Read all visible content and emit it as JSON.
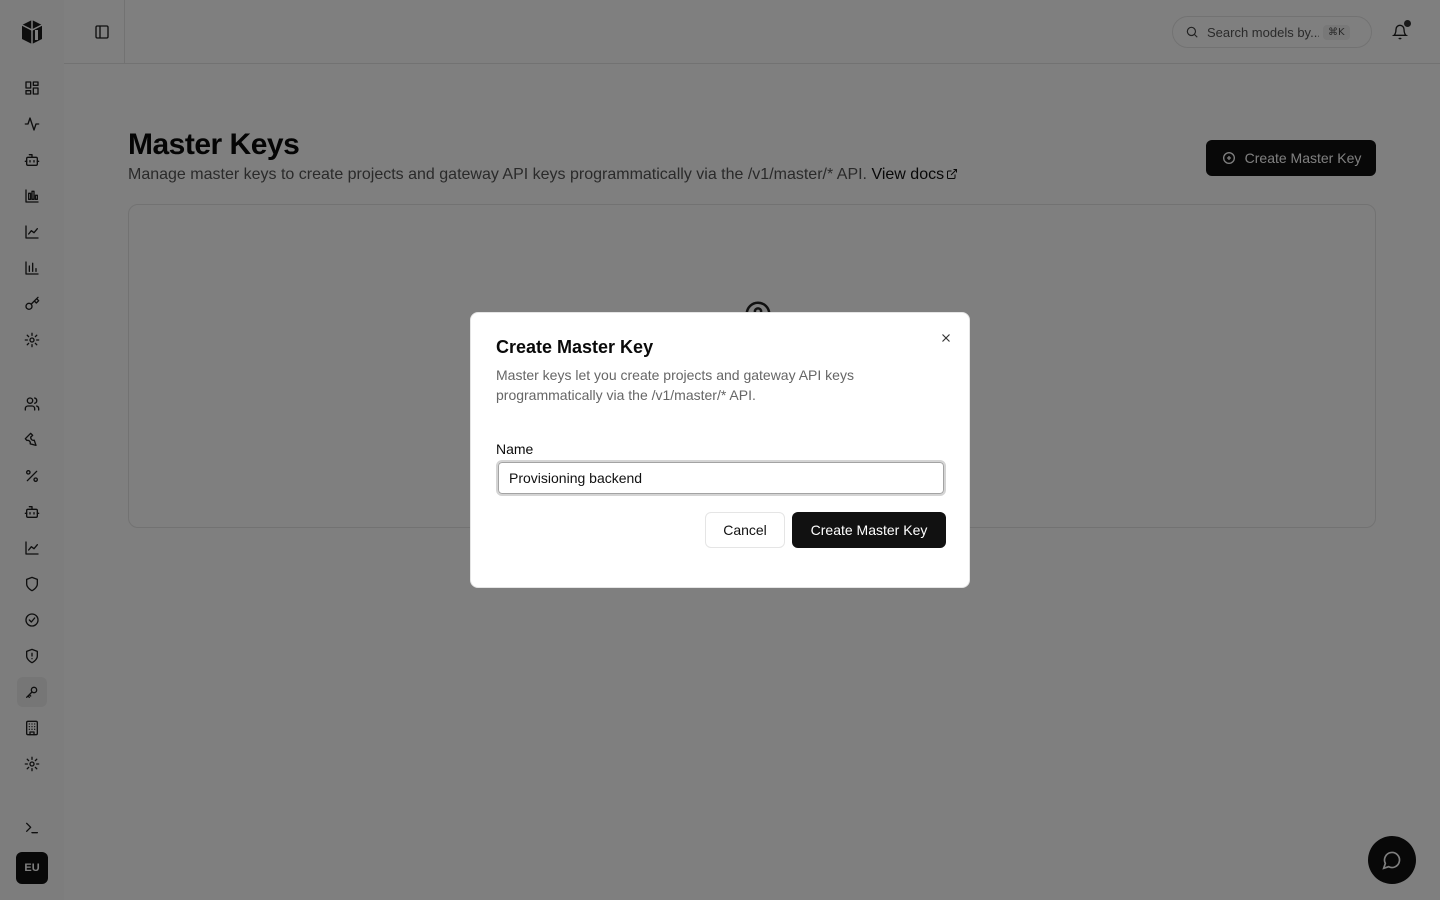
{
  "topbar": {
    "search_placeholder": "Search models by...",
    "search_shortcut": "⌘K"
  },
  "sidebar": {
    "icons_group1": [
      "dashboard-icon",
      "activity-icon",
      "bot-icon",
      "bar-chart-icon",
      "line-chart-icon",
      "bar-chart-2-icon",
      "key-icon",
      "settings-icon"
    ],
    "icons_group2": [
      "users-icon",
      "wrench-icon",
      "percent-icon",
      "bot-icon",
      "trend-icon",
      "shield-icon",
      "check-circle-icon",
      "shield-alert-icon",
      "key-round-icon",
      "building-icon",
      "gear-icon"
    ],
    "terminal_icon": "terminal-icon",
    "avatar_initials": "EU"
  },
  "page": {
    "title": "Master Keys",
    "description": "Manage master keys to create projects and gateway API keys programmatically via the /v1/master/* API.",
    "view_docs_label": "View docs",
    "create_button_label": "Create Master Key"
  },
  "modal": {
    "title": "Create Master Key",
    "description": "Master keys let you create projects and gateway API keys programmatically via the /v1/master/* API.",
    "name_label": "Name",
    "name_value": "Provisioning backend",
    "cancel_label": "Cancel",
    "confirm_label": "Create Master Key"
  }
}
